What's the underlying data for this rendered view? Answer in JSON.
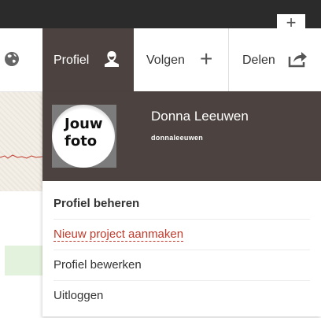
{
  "topbar": {
    "plus_label": "+"
  },
  "nav": {
    "profile_label": "Profiel",
    "follow_label": "Volgen",
    "follow_icon": "+",
    "share_label": "Delen"
  },
  "profile": {
    "avatar_text_line1": "Jouw",
    "avatar_text_line2": "foto",
    "name": "Donna Leeuwen",
    "username": "donnaleeuwen"
  },
  "menu": {
    "items": [
      "Profiel beheren",
      "Nieuw project aanmaken",
      "Profiel bewerken",
      "Uitloggen"
    ]
  },
  "colors": {
    "topbar": "#2b2b2b",
    "profile_dark": "#4c4340",
    "accent_red": "#c0392b"
  }
}
